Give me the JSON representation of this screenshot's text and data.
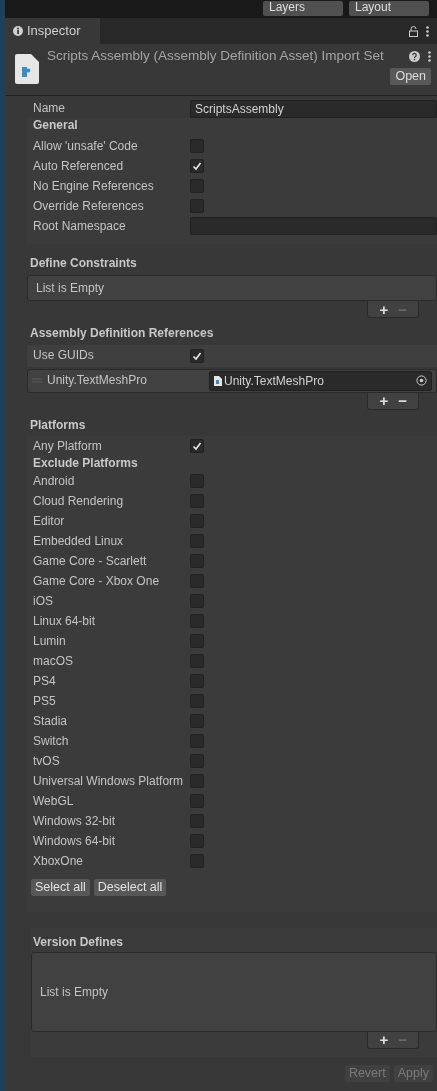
{
  "toolbar": {
    "dropdowns": [
      "Layers",
      "Layout"
    ]
  },
  "tab": {
    "label": "Inspector",
    "selected": true
  },
  "header": {
    "title": "Scripts Assembly (Assembly Definition Asset) Import Set",
    "open_button": "Open"
  },
  "name_field": {
    "label": "Name",
    "value": "ScriptsAssembly"
  },
  "general": {
    "title": "General",
    "options": [
      {
        "label": "Allow 'unsafe' Code",
        "checked": false
      },
      {
        "label": "Auto Referenced",
        "checked": true
      },
      {
        "label": "No Engine References",
        "checked": false
      },
      {
        "label": "Override References",
        "checked": false
      }
    ],
    "root_namespace": {
      "label": "Root Namespace"
    }
  },
  "define_constraints": {
    "title": "Define Constraints",
    "empty_text": "List is Empty",
    "add": "+",
    "remove": "−",
    "remove_disabled": true
  },
  "references": {
    "title": "Assembly Definition References",
    "use_guids": {
      "label": "Use GUIDs",
      "checked": true
    },
    "items": [
      {
        "label": "Unity.TextMeshPro",
        "value": "Unity.TextMeshPro"
      }
    ],
    "add": "+",
    "remove": "−",
    "remove_disabled": false
  },
  "platforms": {
    "title": "Platforms",
    "any_platform": {
      "label": "Any Platform",
      "checked": true
    },
    "exclude_title": "Exclude Platforms",
    "items": [
      {
        "label": "Android",
        "checked": false
      },
      {
        "label": "Cloud Rendering",
        "checked": false
      },
      {
        "label": "Editor",
        "checked": false
      },
      {
        "label": "Embedded Linux",
        "checked": false
      },
      {
        "label": "Game Core - Scarlett",
        "checked": false
      },
      {
        "label": "Game Core - Xbox One",
        "checked": false
      },
      {
        "label": "iOS",
        "checked": false
      },
      {
        "label": "Linux 64-bit",
        "checked": false
      },
      {
        "label": "Lumin",
        "checked": false
      },
      {
        "label": "macOS",
        "checked": false
      },
      {
        "label": "PS4",
        "checked": false
      },
      {
        "label": "PS5",
        "checked": false
      },
      {
        "label": "Stadia",
        "checked": false
      },
      {
        "label": "Switch",
        "checked": false
      },
      {
        "label": "tvOS",
        "checked": false
      },
      {
        "label": "Universal Windows Platform",
        "checked": false
      },
      {
        "label": "WebGL",
        "checked": false
      },
      {
        "label": "Windows 32-bit",
        "checked": false
      },
      {
        "label": "Windows 64-bit",
        "checked": false
      },
      {
        "label": "XboxOne",
        "checked": false
      }
    ],
    "buttons": [
      "Select all",
      "Deselect all"
    ]
  },
  "version_defines": {
    "title": "Version Defines",
    "empty_text": "List is Empty",
    "add": "+",
    "remove": "−",
    "remove_disabled": true
  },
  "footer": {
    "buttons": [
      {
        "label": "Revert",
        "disabled": true
      },
      {
        "label": "Apply",
        "disabled": true
      }
    ]
  }
}
